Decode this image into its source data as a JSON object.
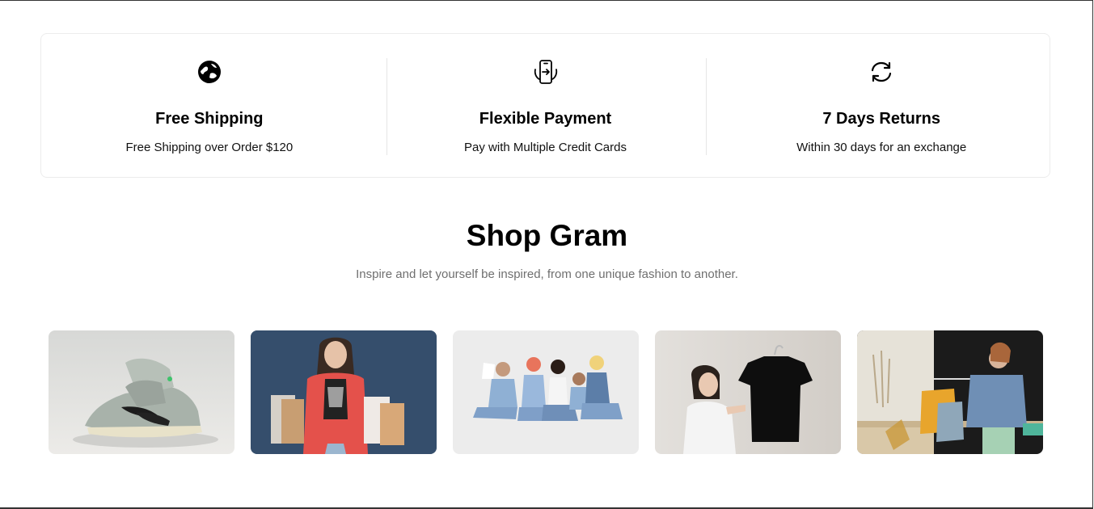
{
  "features": [
    {
      "icon": "globe-icon",
      "title": "Free Shipping",
      "description": "Free Shipping over Order $120"
    },
    {
      "icon": "phone-payment-icon",
      "title": "Flexible Payment",
      "description": "Pay with Multiple Credit Cards"
    },
    {
      "icon": "return-arrows-icon",
      "title": "7 Days Returns",
      "description": "Within 30 days for an exchange"
    }
  ],
  "shop_gram": {
    "title": "Shop Gram",
    "subtitle": "Inspire and let yourself be inspired, from one unique fashion to another."
  },
  "gallery": [
    {
      "name": "sneakers-photo"
    },
    {
      "name": "shopping-woman-photo"
    },
    {
      "name": "group-denim-photo"
    },
    {
      "name": "black-tshirt-photo"
    },
    {
      "name": "clothing-rack-photo"
    }
  ]
}
